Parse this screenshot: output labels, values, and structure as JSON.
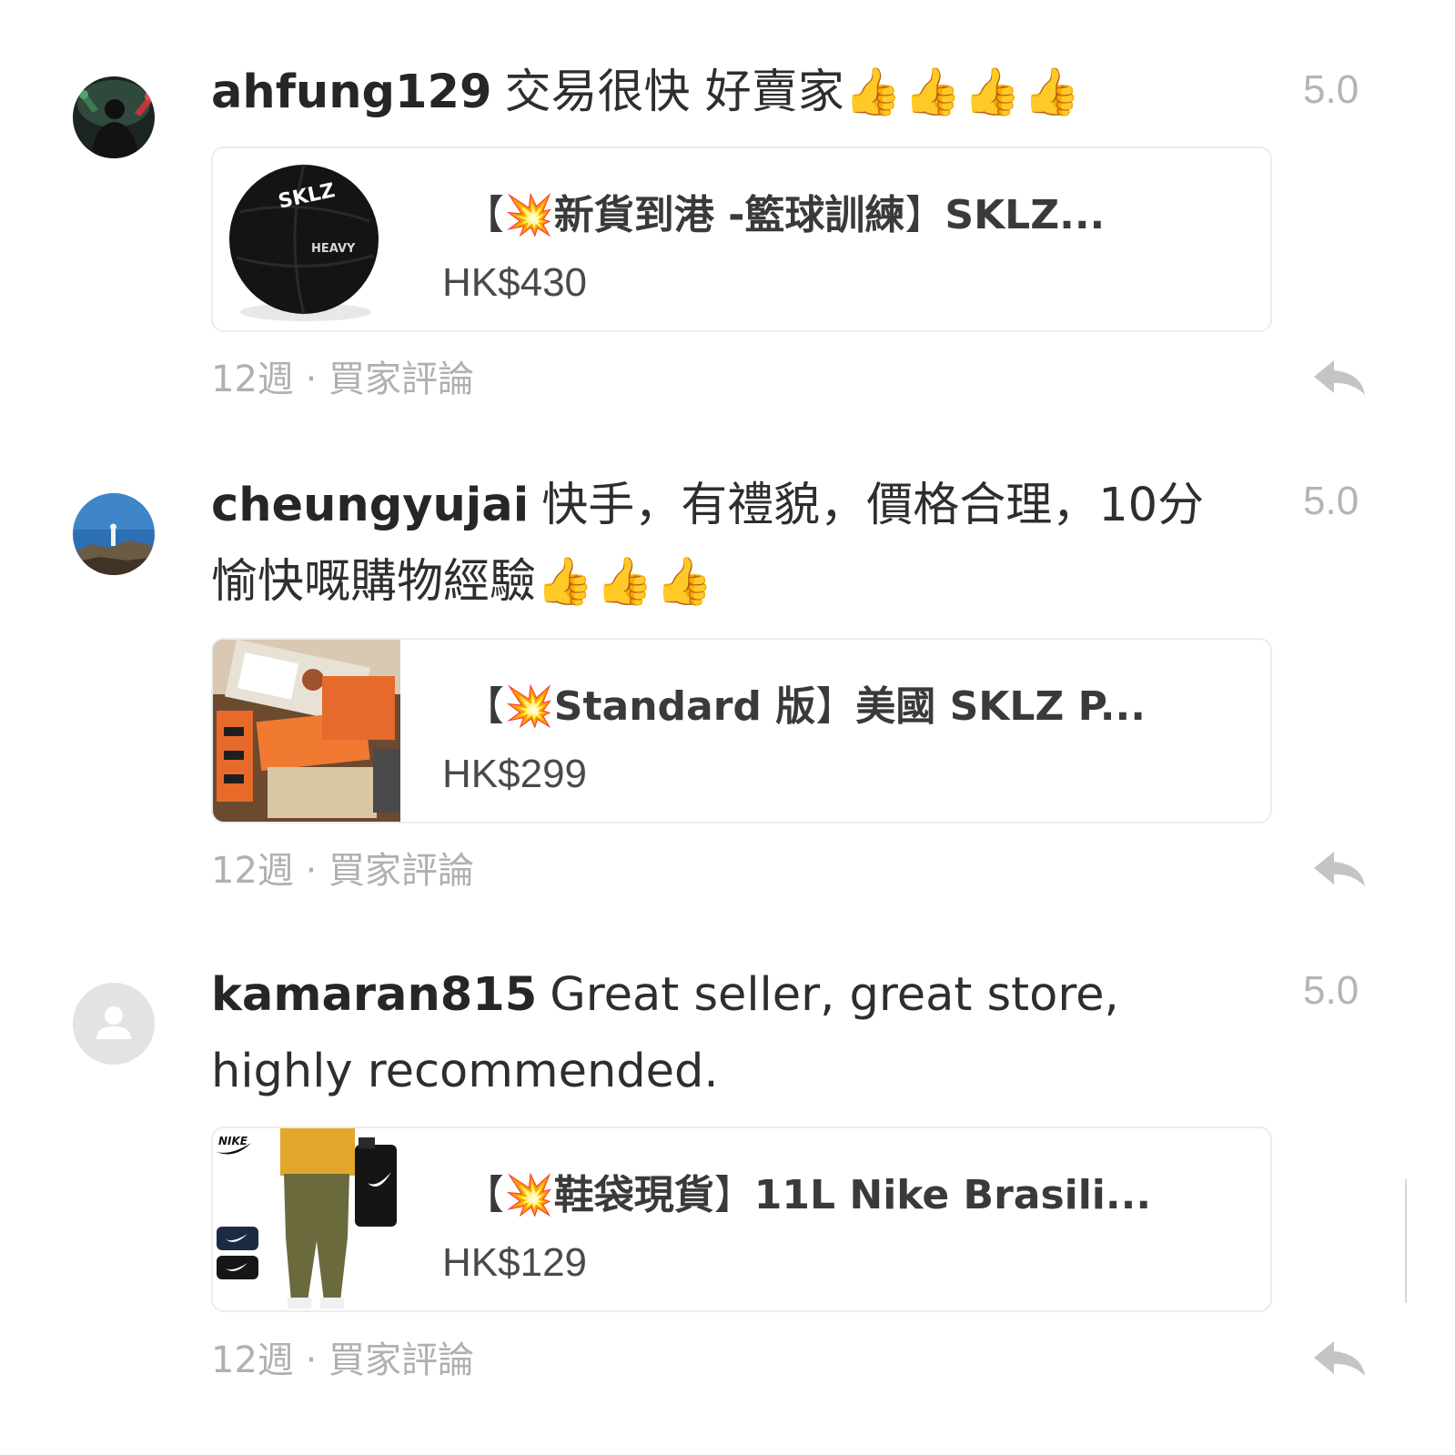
{
  "reviews": [
    {
      "username": "ahfung129",
      "text": "交易很快 好賣家",
      "emoji": "👍👍👍👍",
      "rating": "5.0",
      "avatar_icon": "user-photo-avatar",
      "product": {
        "bracket_open": "【",
        "burst": "💥",
        "title": "新貨到港 -籃球訓練",
        "bracket_close": "】",
        "title_rest": "SKLZ...",
        "price": "HK$430",
        "image_icon": "basketball-image",
        "image_texts": [
          "SKLZ",
          "HEAVY"
        ]
      },
      "meta": "12週 · 買家評論"
    },
    {
      "username": "cheungyujai",
      "text": "快手，有禮貌，價格合理，10分愉快嘅購物經驗",
      "emoji": "👍👍👍",
      "rating": "5.0",
      "avatar_icon": "landscape-photo-avatar",
      "product": {
        "bracket_open": "【",
        "burst": "💥",
        "title": "Standard 版",
        "bracket_close": "】",
        "title_rest": "美國 SKLZ P...",
        "price": "HK$299",
        "image_icon": "boxes-image"
      },
      "meta": "12週 · 買家評論"
    },
    {
      "username": "kamaran815",
      "text": "Great seller, great store, highly recommended.",
      "emoji": "",
      "rating": "5.0",
      "avatar_icon": "default-user-avatar",
      "product": {
        "bracket_open": "【",
        "burst": "💥",
        "title": "鞋袋現貨",
        "bracket_close": "】",
        "title_rest": "11L Nike Brasili...",
        "price": "HK$129",
        "image_icon": "shoe-bag-image",
        "image_texts": [
          "NIKE"
        ]
      },
      "meta": "12週 · 買家評論"
    }
  ],
  "colors": {
    "text": "#2e2e2e",
    "muted": "#b0b0b0",
    "rating": "#b4b4b4",
    "card_border": "#ececec"
  }
}
